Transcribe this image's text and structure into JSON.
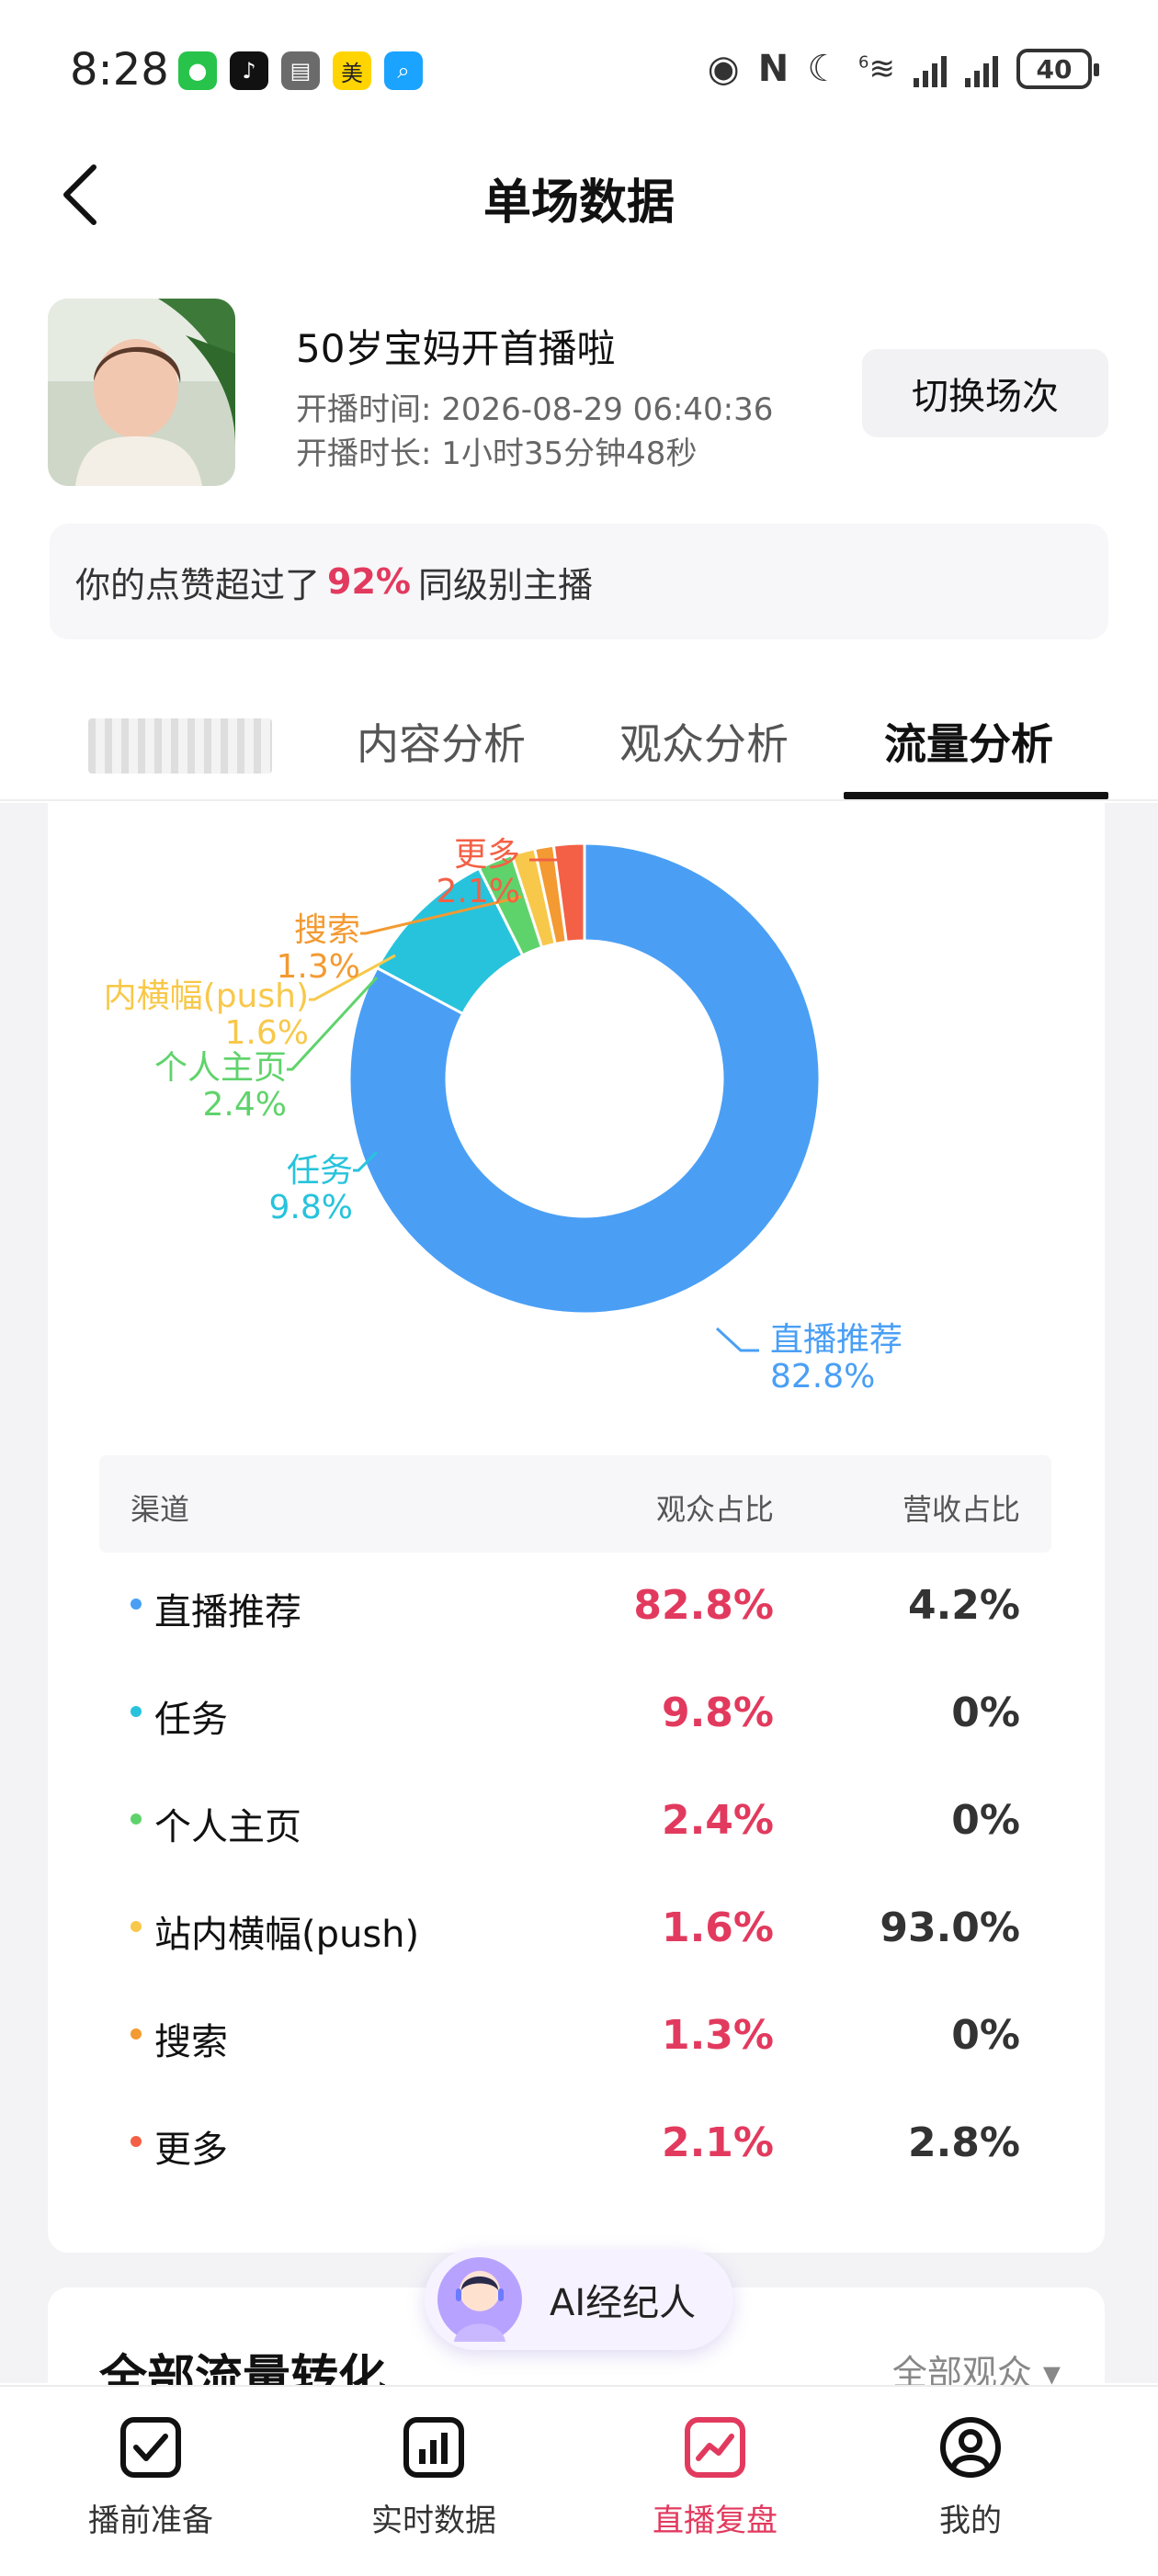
{
  "status_bar": {
    "time": "8:28",
    "battery": "40",
    "network": "6"
  },
  "header": {
    "title": "单场数据"
  },
  "stream": {
    "title": "50岁宝妈开首播啦",
    "start_label": "开播时间:",
    "start_value": "2026-08-29 06:40:36",
    "duration_label": "开播时长:",
    "duration_value": "1小时35分钟48秒",
    "switch_button": "切换场次"
  },
  "like_banner": {
    "prefix": "你的点赞超过了",
    "percent": "92%",
    "suffix": "同级别主播"
  },
  "tabs": [
    {
      "label": "内容分析"
    },
    {
      "label": "观众分析"
    },
    {
      "label": "流量分析",
      "active": true
    }
  ],
  "colors": {
    "accent": "#e23a5e",
    "live_recommend": "#4a9ff5",
    "task": "#27c3dc",
    "homepage": "#5fd36b",
    "push": "#f8c84a",
    "search": "#f39a32",
    "more": "#f36045"
  },
  "chart_data": {
    "type": "pie",
    "style": "donut",
    "slices": [
      {
        "label": "直播推荐",
        "value": 82.8,
        "display": "82.8%",
        "color": "#4a9ff5"
      },
      {
        "label": "任务",
        "value": 9.8,
        "display": "9.8%",
        "color": "#27c3dc"
      },
      {
        "label": "个人主页",
        "value": 2.4,
        "display": "2.4%",
        "color": "#5fd36b"
      },
      {
        "label": "站内横幅(push)",
        "visible_label": "内横幅(push)",
        "value": 1.6,
        "display": "1.6%",
        "color": "#f8c84a"
      },
      {
        "label": "搜索",
        "value": 1.3,
        "display": "1.3%",
        "color": "#f39a32"
      },
      {
        "label": "更多",
        "value": 2.1,
        "display": "2.1%",
        "color": "#f36045"
      }
    ]
  },
  "table": {
    "headers": {
      "channel": "渠道",
      "audience": "观众占比",
      "revenue": "营收占比"
    },
    "rows": [
      {
        "name": "直播推荐",
        "audience": "82.8%",
        "revenue": "4.2%",
        "color": "#4a9ff5"
      },
      {
        "name": "任务",
        "audience": "9.8%",
        "revenue": "0%",
        "color": "#27c3dc"
      },
      {
        "name": "个人主页",
        "audience": "2.4%",
        "revenue": "0%",
        "color": "#5fd36b"
      },
      {
        "name": "站内横幅(push)",
        "audience": "1.6%",
        "revenue": "93.0%",
        "color": "#f8c84a"
      },
      {
        "name": "搜索",
        "audience": "1.3%",
        "revenue": "0%",
        "color": "#f39a32"
      },
      {
        "name": "更多",
        "audience": "2.1%",
        "revenue": "2.8%",
        "color": "#f36045"
      }
    ]
  },
  "conversion": {
    "title": "全部流量转化",
    "filter": "全部观众 ▾"
  },
  "ai_agent": {
    "label": "AI经纪人"
  },
  "bottom_nav": [
    {
      "label": "播前准备",
      "icon": "checkbox-icon"
    },
    {
      "label": "实时数据",
      "icon": "bar-chart-icon"
    },
    {
      "label": "直播复盘",
      "icon": "trend-icon",
      "active": true
    },
    {
      "label": "我的",
      "icon": "user-icon"
    }
  ]
}
